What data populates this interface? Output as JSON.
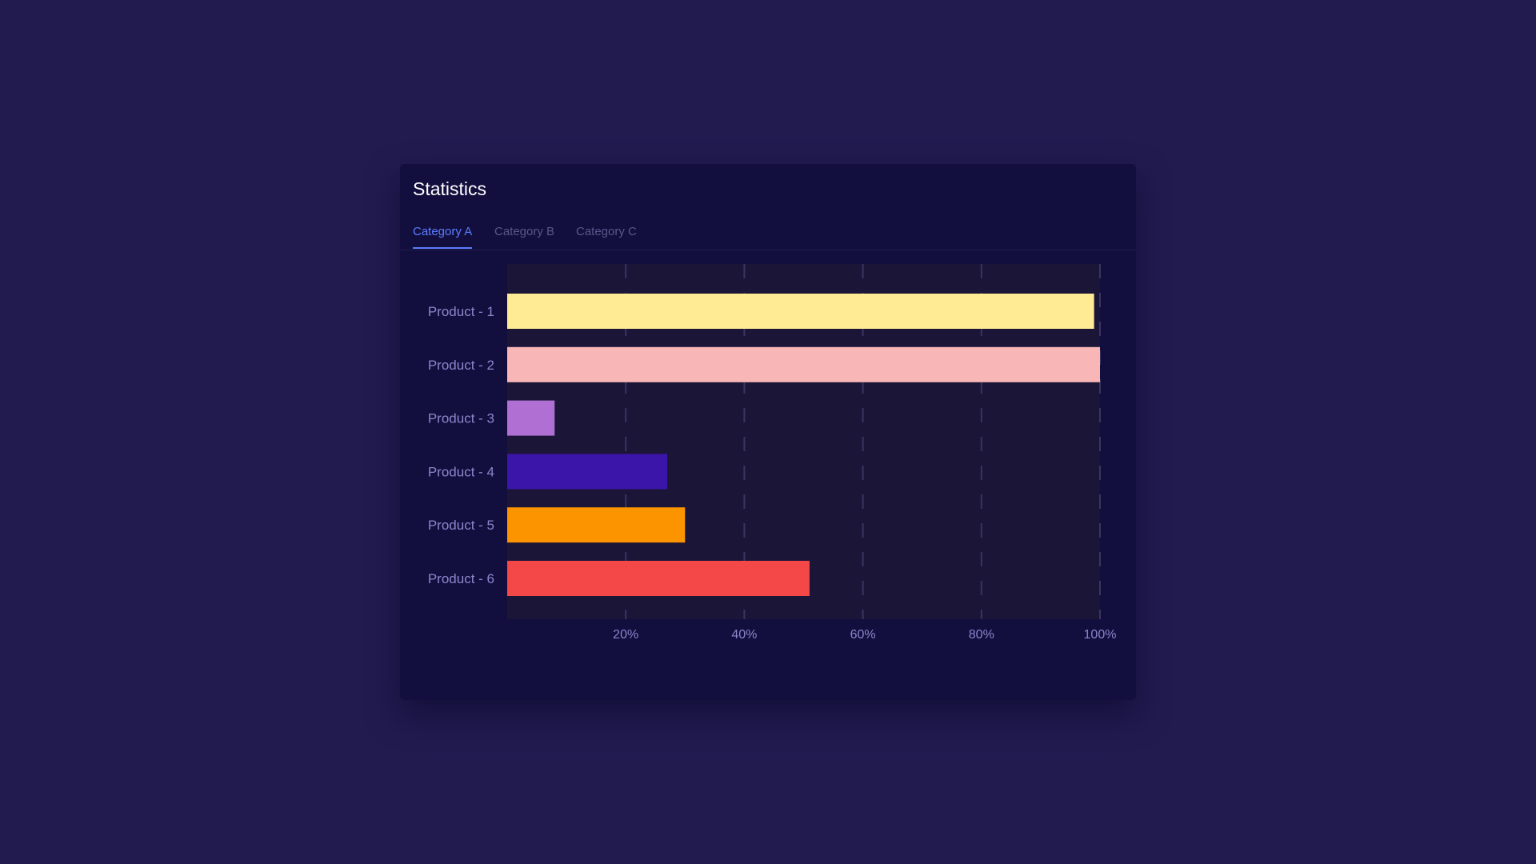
{
  "card": {
    "title": "Statistics"
  },
  "tabs": [
    {
      "label": "Category A",
      "active": true
    },
    {
      "label": "Category B",
      "active": false
    },
    {
      "label": "Category C",
      "active": false
    }
  ],
  "colors": {
    "page_background": "#211b50",
    "card_background": "#120f3e",
    "plot_background": "#1b1538",
    "grid_line": "#3a3460",
    "label_text": "#8c86cc",
    "tab_active": "#5b7cff",
    "tab_inactive": "#5a5689"
  },
  "chart_data": {
    "type": "bar",
    "orientation": "horizontal",
    "categories": [
      "Product - 1",
      "Product - 2",
      "Product - 3",
      "Product - 4",
      "Product - 5",
      "Product - 6"
    ],
    "values": [
      99,
      100,
      8,
      27,
      30,
      51
    ],
    "bar_colors": [
      "#ffeb93",
      "#f8b6b6",
      "#b06fd2",
      "#3b15aa",
      "#fc9400",
      "#f44848"
    ],
    "xlim": [
      0,
      100
    ],
    "x_ticks": [
      20,
      40,
      60,
      80,
      100
    ],
    "x_tick_labels": [
      "20%",
      "40%",
      "60%",
      "80%",
      "100%"
    ],
    "grid": "vertical dashed"
  }
}
